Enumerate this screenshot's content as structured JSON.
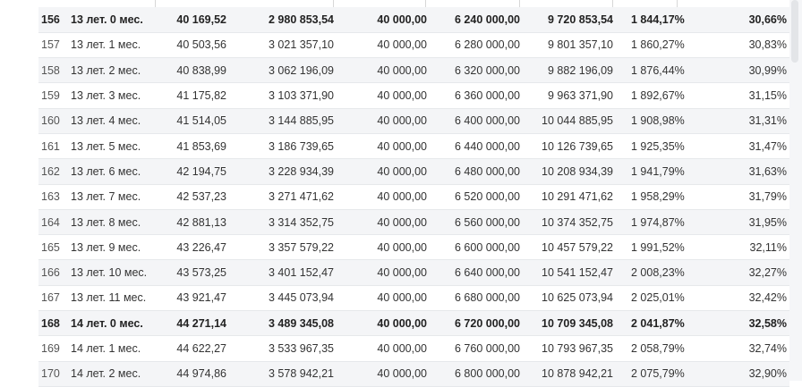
{
  "table": {
    "rows": [
      {
        "n": "156",
        "period": "13 лет. 0 мес.",
        "a": "40 169,52",
        "b": "2 980 853,54",
        "c": "40 000,00",
        "d": "6 240 000,00",
        "e": "9 720 853,54",
        "f": "1 844,17%",
        "g": "30,66%",
        "year_row": true
      },
      {
        "n": "157",
        "period": "13 лет. 1 мес.",
        "a": "40 503,56",
        "b": "3 021 357,10",
        "c": "40 000,00",
        "d": "6 280 000,00",
        "e": "9 801 357,10",
        "f": "1 860,27%",
        "g": "30,83%",
        "year_row": false
      },
      {
        "n": "158",
        "period": "13 лет. 2 мес.",
        "a": "40 838,99",
        "b": "3 062 196,09",
        "c": "40 000,00",
        "d": "6 320 000,00",
        "e": "9 882 196,09",
        "f": "1 876,44%",
        "g": "30,99%",
        "year_row": false
      },
      {
        "n": "159",
        "period": "13 лет. 3 мес.",
        "a": "41 175,82",
        "b": "3 103 371,90",
        "c": "40 000,00",
        "d": "6 360 000,00",
        "e": "9 963 371,90",
        "f": "1 892,67%",
        "g": "31,15%",
        "year_row": false
      },
      {
        "n": "160",
        "period": "13 лет. 4 мес.",
        "a": "41 514,05",
        "b": "3 144 885,95",
        "c": "40 000,00",
        "d": "6 400 000,00",
        "e": "10 044 885,95",
        "f": "1 908,98%",
        "g": "31,31%",
        "year_row": false
      },
      {
        "n": "161",
        "period": "13 лет. 5 мес.",
        "a": "41 853,69",
        "b": "3 186 739,65",
        "c": "40 000,00",
        "d": "6 440 000,00",
        "e": "10 126 739,65",
        "f": "1 925,35%",
        "g": "31,47%",
        "year_row": false
      },
      {
        "n": "162",
        "period": "13 лет. 6 мес.",
        "a": "42 194,75",
        "b": "3 228 934,39",
        "c": "40 000,00",
        "d": "6 480 000,00",
        "e": "10 208 934,39",
        "f": "1 941,79%",
        "g": "31,63%",
        "year_row": false
      },
      {
        "n": "163",
        "period": "13 лет. 7 мес.",
        "a": "42 537,23",
        "b": "3 271 471,62",
        "c": "40 000,00",
        "d": "6 520 000,00",
        "e": "10 291 471,62",
        "f": "1 958,29%",
        "g": "31,79%",
        "year_row": false
      },
      {
        "n": "164",
        "period": "13 лет. 8 мес.",
        "a": "42 881,13",
        "b": "3 314 352,75",
        "c": "40 000,00",
        "d": "6 560 000,00",
        "e": "10 374 352,75",
        "f": "1 974,87%",
        "g": "31,95%",
        "year_row": false
      },
      {
        "n": "165",
        "period": "13 лет. 9 мес.",
        "a": "43 226,47",
        "b": "3 357 579,22",
        "c": "40 000,00",
        "d": "6 600 000,00",
        "e": "10 457 579,22",
        "f": "1 991,52%",
        "g": "32,11%",
        "year_row": false
      },
      {
        "n": "166",
        "period": "13 лет. 10 мес.",
        "a": "43 573,25",
        "b": "3 401 152,47",
        "c": "40 000,00",
        "d": "6 640 000,00",
        "e": "10 541 152,47",
        "f": "2 008,23%",
        "g": "32,27%",
        "year_row": false
      },
      {
        "n": "167",
        "period": "13 лет. 11 мес.",
        "a": "43 921,47",
        "b": "3 445 073,94",
        "c": "40 000,00",
        "d": "6 680 000,00",
        "e": "10 625 073,94",
        "f": "2 025,01%",
        "g": "32,42%",
        "year_row": false
      },
      {
        "n": "168",
        "period": "14 лет. 0 мес.",
        "a": "44 271,14",
        "b": "3 489 345,08",
        "c": "40 000,00",
        "d": "6 720 000,00",
        "e": "10 709 345,08",
        "f": "2 041,87%",
        "g": "32,58%",
        "year_row": true
      },
      {
        "n": "169",
        "period": "14 лет. 1 мес.",
        "a": "44 622,27",
        "b": "3 533 967,35",
        "c": "40 000,00",
        "d": "6 760 000,00",
        "e": "10 793 967,35",
        "f": "2 058,79%",
        "g": "32,74%",
        "year_row": false
      },
      {
        "n": "170",
        "period": "14 лет. 2 мес.",
        "a": "44 974,86",
        "b": "3 578 942,21",
        "c": "40 000,00",
        "d": "6 800 000,00",
        "e": "10 878 942,21",
        "f": "2 075,79%",
        "g": "32,90%",
        "year_row": false
      }
    ]
  },
  "colors": {
    "row_alt_bg": "#f4f5f7",
    "row_border": "#e6e8eb",
    "text": "#333333"
  }
}
